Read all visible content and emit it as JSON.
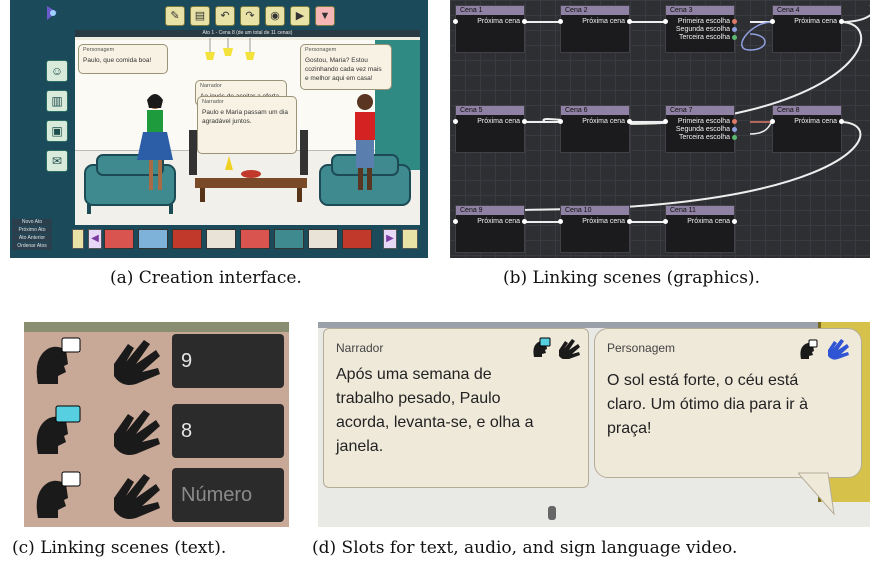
{
  "panel_a": {
    "caption": "(a) Creation interface.",
    "header_text": "Ato 1 - Cena 8 (de um total de 11 cenas)",
    "bubble_left": {
      "speaker": "Personagem",
      "text": "Paulo, que comida boa!"
    },
    "bubble_right": {
      "speaker": "Personagem",
      "text": "Gostou, Maria? Estou cozinhando cada vez mais e melhor aqui em casa!"
    },
    "bubble_center_back": {
      "speaker": "Narrador",
      "text": "Ao invés de aceitar a oferta"
    },
    "bubble_center_front": {
      "speaker": "Narrador",
      "text": "Paulo e Maria passam um dia agradável juntos."
    },
    "menu": [
      "Novo Ato",
      "Próximo Ato",
      "Ato Anterior",
      "Ordenar Atos"
    ]
  },
  "panel_b": {
    "caption": "(b) Linking scenes (graphics).",
    "nodes": [
      {
        "title": "Cena 1",
        "outputs": [
          "Próxima cena"
        ]
      },
      {
        "title": "Cena 2",
        "outputs": [
          "Próxima cena"
        ]
      },
      {
        "title": "Cena 3",
        "outputs": [
          "Primeira escolha",
          "Segunda escolha",
          "Terceira escolha"
        ]
      },
      {
        "title": "Cena 4",
        "outputs": [
          "Próxima cena"
        ]
      },
      {
        "title": "Cena 5",
        "outputs": [
          "Próxima cena"
        ]
      },
      {
        "title": "Cena 6",
        "outputs": [
          "Próxima cena"
        ]
      },
      {
        "title": "Cena 7",
        "outputs": [
          "Primeira escolha",
          "Segunda escolha",
          "Terceira escolha"
        ]
      },
      {
        "title": "Cena 8",
        "outputs": [
          "Próxima cena"
        ]
      },
      {
        "title": "Cena 9",
        "outputs": [
          "Próxima cena"
        ]
      },
      {
        "title": "Cena 10",
        "outputs": [
          "Próxima cena"
        ]
      },
      {
        "title": "Cena 11",
        "outputs": [
          "Próxima cena"
        ]
      }
    ]
  },
  "panel_c": {
    "caption": "(c) Linking scenes (text).",
    "fields": [
      "9",
      "8"
    ],
    "placeholder": "Número"
  },
  "panel_d": {
    "caption": "(d) Slots for text, audio, and sign language video.",
    "narrator": {
      "label": "Narrador",
      "lines": [
        "Após uma semana de",
        "trabalho pesado, Paulo",
        "acorda, levanta-se, e olha a",
        "janela."
      ]
    },
    "character": {
      "label": "Personagem",
      "lines": [
        "O sol está forte, o céu está",
        "claro. Um ótimo dia para ir à",
        "praça!"
      ]
    }
  },
  "colors": {
    "node_header": "#8f81a3",
    "choice_1": "#e07b6a",
    "choice_2": "#8fa0e0",
    "choice_3": "#5cb870"
  }
}
